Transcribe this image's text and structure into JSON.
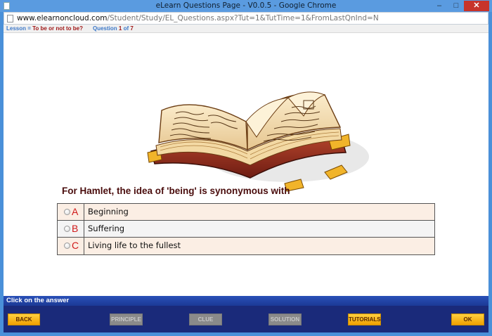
{
  "window": {
    "title": "eLearn Questions Page - V0.0.5 - Google Chrome",
    "minimize": "–",
    "maximize": "□",
    "close": "✕"
  },
  "address": {
    "host": "www.elearnoncloud.com",
    "path": "/Student/Study/EL_Questions.aspx?Tut=1&TutTime=1&FromLastQnInd=N"
  },
  "info": {
    "lesson_label": "Lesson",
    "lesson_sep": " = ",
    "lesson_value": "To be or not to be?",
    "question_label": "Question",
    "question_current": "1",
    "question_of": "of",
    "question_total": "7"
  },
  "question": {
    "text": "For Hamlet, the idea of 'being' is synonymous with"
  },
  "answers": [
    {
      "letter": "A",
      "text": "Beginning"
    },
    {
      "letter": "B",
      "text": "Suffering"
    },
    {
      "letter": "C",
      "text": "Living life to the fullest"
    }
  ],
  "hint": "Click on the answer",
  "buttons": {
    "back": "BACK",
    "principle": "PRINCIPLE",
    "clue": "CLUE",
    "solution": "SOLUTION",
    "tutorials": "TUTORIALS",
    "ok": "OK"
  },
  "colors": {
    "accent": "#f0a000",
    "question": "#4a0d0d",
    "letter": "#d01a1a"
  }
}
